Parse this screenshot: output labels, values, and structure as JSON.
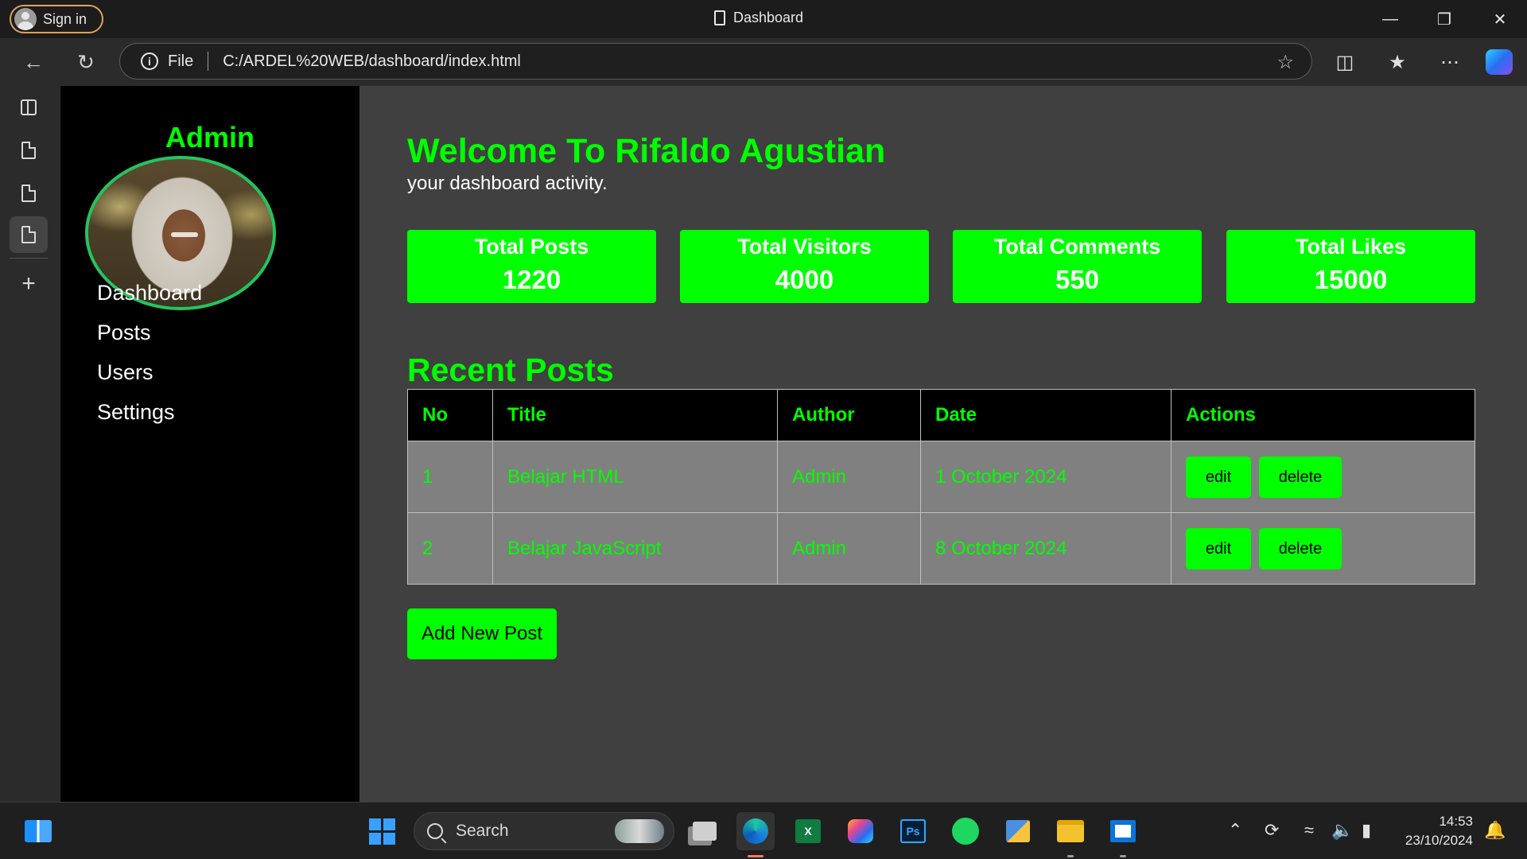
{
  "browser": {
    "signin_label": "Sign in",
    "tab_title": "Dashboard",
    "address_scheme": "File",
    "address_url": "C:/ARDEL%20WEB/dashboard/index.html",
    "icons": [
      "back-icon",
      "refresh-icon",
      "info-icon",
      "favorite-star-icon",
      "split-screen-icon",
      "favorites-icon",
      "more-icon",
      "copilot-icon",
      "minimize-icon",
      "restore-icon",
      "close-icon"
    ]
  },
  "vertical_tabs": {
    "icons": [
      "tab-actions-icon",
      "page-icon",
      "page-icon",
      "page-icon",
      "new-tab-icon"
    ]
  },
  "sidebar": {
    "title": "Admin",
    "items": [
      {
        "label": "Dashboard"
      },
      {
        "label": "Posts"
      },
      {
        "label": "Users"
      },
      {
        "label": "Settings"
      }
    ]
  },
  "main": {
    "welcome": "Welcome To Rifaldo Agustian",
    "subtitle": "your dashboard activity.",
    "stats": [
      {
        "label": "Total Posts",
        "value": "1220"
      },
      {
        "label": "Total Visitors",
        "value": "4000"
      },
      {
        "label": "Total Comments",
        "value": "550"
      },
      {
        "label": "Total Likes",
        "value": "15000"
      }
    ],
    "recent_title": "Recent Posts",
    "table": {
      "headers": [
        "No",
        "Title",
        "Author",
        "Date",
        "Actions"
      ],
      "rows": [
        {
          "no": "1",
          "title": "Belajar HTML",
          "author": "Admin",
          "date": "1 October 2024"
        },
        {
          "no": "2",
          "title": "Belajar JavaScript",
          "author": "Admin",
          "date": "8 October 2024"
        }
      ],
      "edit_label": "edit",
      "delete_label": "delete"
    },
    "add_button": "Add New Post"
  },
  "taskbar": {
    "search_placeholder": "Search",
    "time": "14:53",
    "date": "23/10/2024",
    "apps": [
      "widgets-icon",
      "start-icon",
      "task-view-icon",
      "edge-icon",
      "excel-icon",
      "copilot-icon",
      "photoshop-icon",
      "spotify-icon",
      "network-app-icon",
      "file-explorer-icon",
      "store-icon"
    ],
    "tray_icons": [
      "chevron-up-icon",
      "sync-icon",
      "wifi-icon",
      "volume-icon",
      "battery-icon",
      "notification-bell-icon"
    ]
  },
  "colors": {
    "accent_green": "#00ff00",
    "page_bg": "#404040",
    "sidebar_bg": "#000000",
    "table_row_bg": "#808080"
  }
}
